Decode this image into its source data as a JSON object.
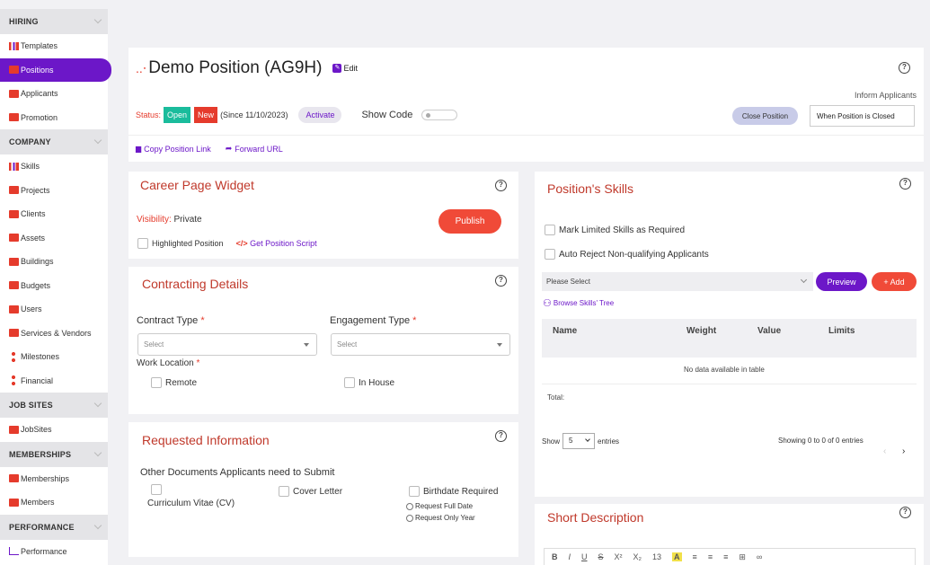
{
  "sidebar": {
    "sections": [
      {
        "title": "HIRING",
        "items": [
          "Templates",
          "Positions",
          "Applicants",
          "Promotion"
        ]
      },
      {
        "title": "COMPANY",
        "items": [
          "Skills",
          "Projects",
          "Clients",
          "Assets",
          "Buildings",
          "Budgets",
          "Users",
          "Services & Vendors",
          "Milestones",
          "Financial"
        ]
      },
      {
        "title": "JOB SITES",
        "items": [
          "JobSites"
        ]
      },
      {
        "title": "MEMBERSHIPS",
        "items": [
          "Memberships",
          "Members"
        ]
      },
      {
        "title": "PERFORMANCE",
        "items": [
          "Performance"
        ]
      }
    ],
    "active_item": "Positions"
  },
  "header": {
    "title": "Demo Position (AG9H)",
    "edit_label": "Edit",
    "status_label": "Status:",
    "status_open": "Open",
    "status_new": "New",
    "since": "(Since 11/10/2023)",
    "activate_label": "Activate",
    "show_code_label": "Show Code",
    "inform_label": "Inform Applicants",
    "close_position_label": "Close Position",
    "inform_value": "When Position is Closed",
    "copy_link_label": "Copy Position Link",
    "forward_url_label": "Forward URL"
  },
  "career_widget": {
    "title": "Career Page Widget",
    "visibility_label": "Visibility:",
    "visibility_value": "Private",
    "publish_label": "Publish",
    "highlighted_label": "Highlighted Position",
    "script_label": "Get Position Script"
  },
  "contracting": {
    "title": "Contracting Details",
    "contract_type_label": "Contract Type",
    "engagement_type_label": "Engagement Type",
    "select_placeholder": "Select",
    "work_location_label": "Work Location",
    "remote_label": "Remote",
    "in_house_label": "In House",
    "required_mark": "*"
  },
  "requested_info": {
    "title": "Requested Information",
    "subtitle": "Other Documents Applicants need to Submit",
    "cv_label": "Curriculum Vitae (CV)",
    "cover_label": "Cover Letter",
    "birthdate_label": "Birthdate Required",
    "full_date_label": "Request Full Date",
    "only_year_label": "Request Only Year"
  },
  "skills": {
    "title": "Position's Skills",
    "limited_label": "Mark Limited Skills as Required",
    "reject_label": "Auto Reject Non-qualifying Applicants",
    "select_placeholder": "Please Select",
    "preview_label": "Preview",
    "add_label": "+ Add",
    "browse_label": "Browse Skills' Tree",
    "columns": [
      "Name",
      "Weight",
      "Value",
      "Limits"
    ],
    "empty_text": "No data available in table",
    "total_label": "Total:",
    "show_label": "Show",
    "entries_value": "5",
    "entries_label": "entries",
    "showing_text": "Showing 0 to 0 of 0 entries"
  },
  "short_description": {
    "title": "Short Description",
    "toolbar": [
      "B",
      "I",
      "U",
      "S",
      "X²",
      "X₂",
      "13",
      "A",
      "≡",
      "≡",
      "≡",
      "⊞",
      "∞"
    ]
  },
  "colors": {
    "accent": "#6c17c8",
    "brand_red": "#e53b2c",
    "open_green": "#1abc9c"
  }
}
